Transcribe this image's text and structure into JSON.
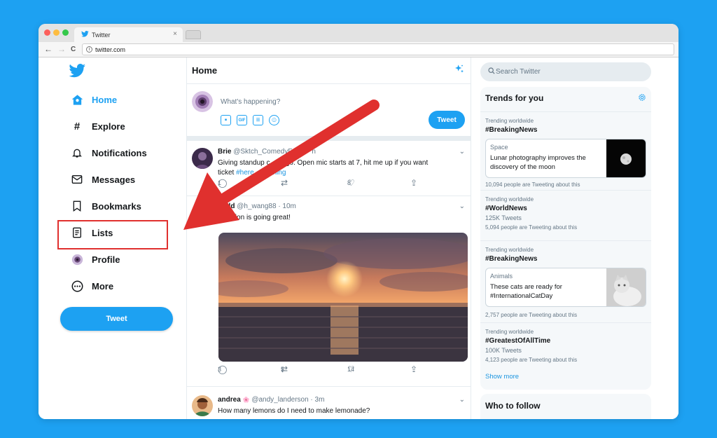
{
  "browser": {
    "tab_title": "Twitter",
    "tab_close": "×",
    "url": "twitter.com",
    "back": "←",
    "forward": "→",
    "reload": "C",
    "info": "i"
  },
  "sidebar": {
    "items": [
      {
        "label": "Home",
        "icon": "home-icon"
      },
      {
        "label": "Explore",
        "icon": "hashtag-icon"
      },
      {
        "label": "Notifications",
        "icon": "bell-icon"
      },
      {
        "label": "Messages",
        "icon": "envelope-icon"
      },
      {
        "label": "Bookmarks",
        "icon": "bookmark-icon"
      },
      {
        "label": "Lists",
        "icon": "list-icon"
      },
      {
        "label": "Profile",
        "icon": "avatar-icon"
      },
      {
        "label": "More",
        "icon": "more-icon"
      }
    ],
    "tweet_button": "Tweet",
    "highlight_color": "#e0302e"
  },
  "feed": {
    "title": "Home",
    "compose_placeholder": "What's happening?",
    "compose_tweet": "Tweet",
    "tweets": [
      {
        "name": "Brie",
        "handle": "@Sktch_ComedyF",
        "handle_end": "n",
        "text_line1": "Giving standup c",
        "text_line1_end": "a go. Open mic starts at 7, hit me up if you want",
        "text_line2": "ticket ",
        "hashtag": "#here",
        "hashtag_end": "ming",
        "replies": "1",
        "retweets": "",
        "likes": "8"
      },
      {
        "name": "arold",
        "handle": "@h_wang88 · 10m",
        "text": "Vacation is going great!",
        "replies": "3",
        "retweets": "5",
        "likes": "14"
      },
      {
        "name": "andrea",
        "badge": "🌸",
        "handle": "@andy_landerson · 3m",
        "text": "How many lemons do I need to make lemonade?"
      }
    ]
  },
  "right": {
    "search_placeholder": "Search Twitter",
    "trends_title": "Trends for you",
    "trends": [
      {
        "context": "Trending worldwide",
        "name": "#BreakingNews",
        "card_category": "Space",
        "card_text": "Lunar photography improves the discovery of the moon",
        "meta": "10,094 people are Tweeting about this"
      },
      {
        "context": "Trending worldwide",
        "name": "#WorldNews",
        "count": "125K Tweets",
        "meta": "5,094 people are Tweeting about this"
      },
      {
        "context": "Trending worldwide",
        "name": "#BreakingNews",
        "card_category": "Animals",
        "card_text": "These cats are ready for #InternationalCatDay",
        "meta": "2,757 people are Tweeting about this"
      },
      {
        "context": "Trending worldwide",
        "name": "#GreatestOfAllTime",
        "count": "100K Tweets",
        "meta": "4,123 people are Tweeting about this"
      }
    ],
    "show_more": "Show more",
    "who_to_follow": "Who to follow"
  },
  "colors": {
    "accent": "#1da1f2",
    "background": "#1da1f2",
    "arrow": "#e0302e"
  }
}
